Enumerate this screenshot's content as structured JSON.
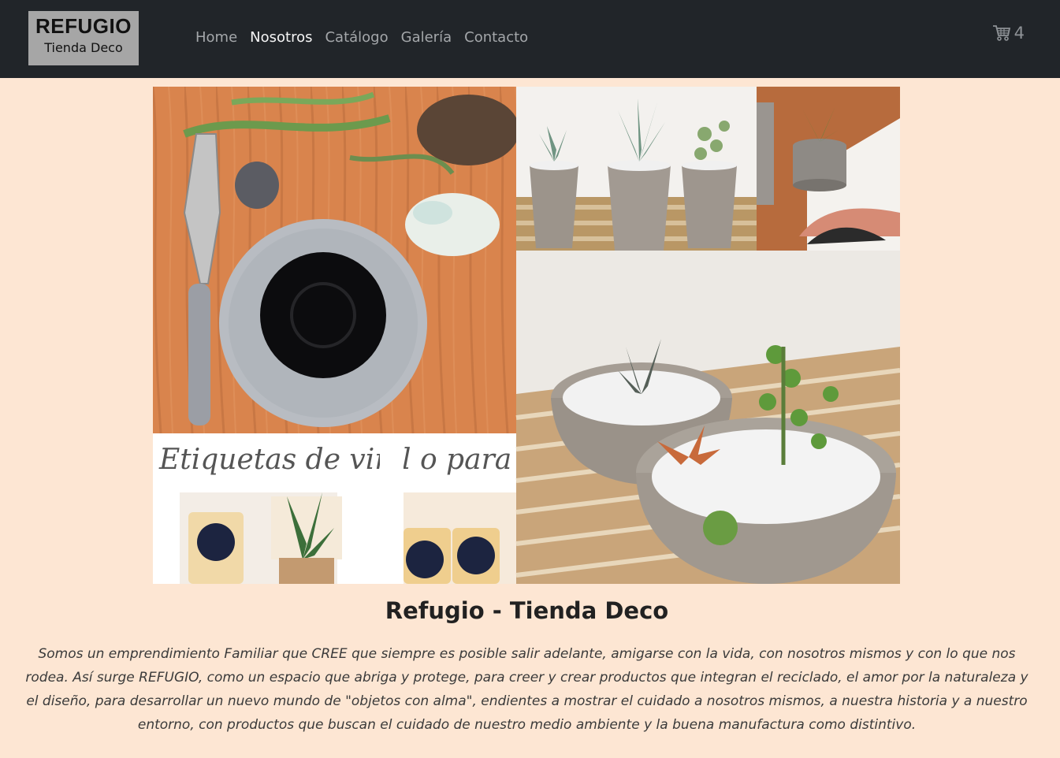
{
  "brand": {
    "title": "REFUGIO",
    "subtitle": "Tienda Deco"
  },
  "nav": {
    "items": [
      {
        "label": "Home",
        "active": false
      },
      {
        "label": "Nosotros",
        "active": true
      },
      {
        "label": "Catálogo",
        "active": false
      },
      {
        "label": "Galería",
        "active": false
      },
      {
        "label": "Contacto",
        "active": false
      }
    ]
  },
  "cart": {
    "icon": "cart-icon",
    "count": "4"
  },
  "hero": {
    "overlay_text": "Etiquetas de vinil  o para"
  },
  "about": {
    "title": "Refugio - Tienda Deco",
    "description": "Somos un emprendimiento Familiar que CREE que siempre es posible salir adelante, amigarse con la vida, con nosotros mismos y con lo que nos rodea. Así surge REFUGIO, como un espacio que abriga y protege, para creer y crear productos que integran el reciclado, el amor por la naturaleza y el diseño, para desarrollar un nuevo mundo de \"objetos con alma\", endientes a mostrar el cuidado a nosotros mismos, a nuestra historia y a nuestro entorno, con productos que buscan el cuidado de nuestro medio ambiente y la buena manufactura como distintivo."
  },
  "colors": {
    "navbar": "#212529",
    "page_background": "#fde6d3",
    "brand_box": "#a6a6a6"
  }
}
